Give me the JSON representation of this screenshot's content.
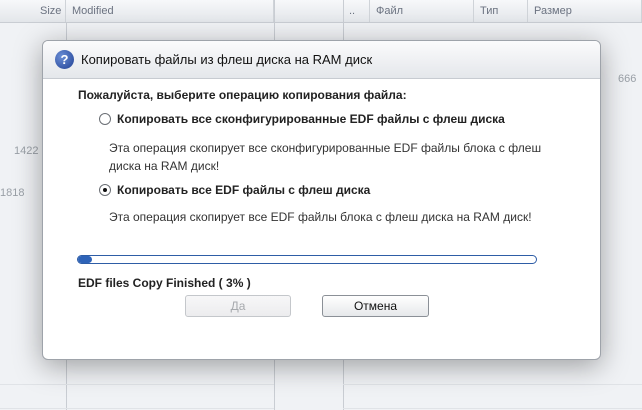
{
  "background": {
    "left_headers": [
      "Size",
      "Modified"
    ],
    "right_headers": [
      "..",
      "Файл",
      "Тип",
      "Размер"
    ],
    "fragments": [
      "1422",
      "1818",
      "666"
    ]
  },
  "dialog": {
    "title": "Копировать файлы из флеш диска на RAM диск",
    "title_icon": "question-icon",
    "prompt": "Пожалуйста, выберите операцию копирования файла:",
    "options": [
      {
        "label": "Копировать все сконфигурированные EDF файлы с флеш диска",
        "description": "Эта операция скопирует все сконфигурированные  EDF файлы блока с флеш диска на RAM диск!",
        "selected": false
      },
      {
        "label": "Копировать все EDF файлы с флеш диска",
        "description": "Эта операция скопирует все EDF файлы блока с флеш диска на RAM диск!",
        "selected": true
      }
    ],
    "progress_percent": 3,
    "status": "EDF files Copy Finished   ( 3% )",
    "ok_label": "Да",
    "cancel_label": "Отмена",
    "accent_color": "#2e63b8"
  }
}
